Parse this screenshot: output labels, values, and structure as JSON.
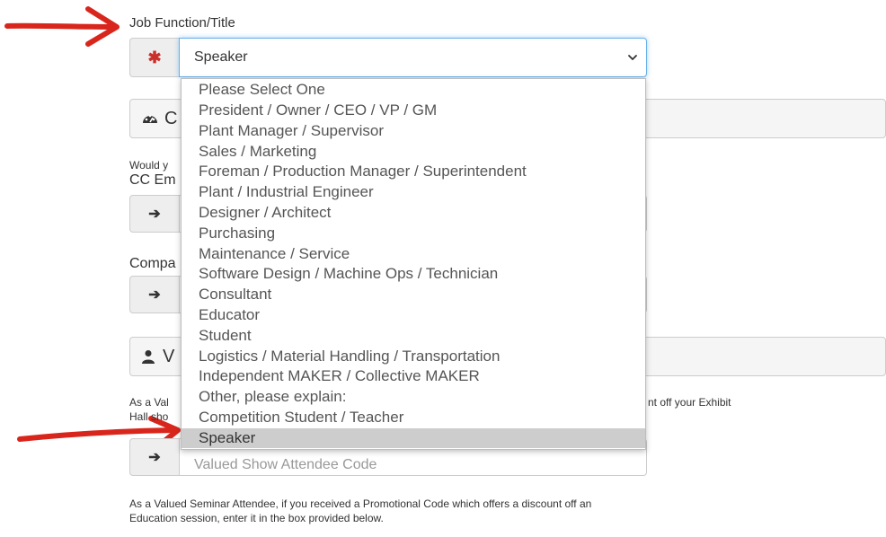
{
  "job_function": {
    "label": "Job Function/Title",
    "required_mark": "✱",
    "selected_value": "Speaker",
    "options": [
      "Please Select One",
      "President / Owner / CEO / VP / GM",
      "Plant Manager / Supervisor",
      "Sales / Marketing",
      "Foreman / Production Manager / Superintendent",
      "Plant / Industrial Engineer",
      "Designer / Architect",
      "Purchasing",
      "Maintenance / Service",
      "Software Design / Machine Ops / Technician",
      "Consultant",
      "Educator",
      "Student",
      "Logistics / Material Handling / Transportation",
      "Independent MAKER / Collective MAKER",
      "Other, please explain:",
      "Competition Student / Teacher",
      "Speaker"
    ]
  },
  "company_section": {
    "heading_partial": "C"
  },
  "cc_email": {
    "intro_partial": "Would y",
    "label_partial": "CC Em"
  },
  "company": {
    "label_partial": "Compa"
  },
  "valued_section": {
    "heading_partial": "V"
  },
  "exhibit": {
    "help_line1_left": "As a Val",
    "help_line1_right": "nt off your Exhibit",
    "help_line2_left": "Hall sho",
    "code_placeholder": "Valued Show Attendee Code"
  },
  "seminar": {
    "help_line1": "As a Valued Seminar Attendee, if you received a Promotional Code which offers a discount off an",
    "help_line2": "Education session, enter it in the box provided below."
  },
  "colors": {
    "required": "#c9302c",
    "focus_border": "#66afe9",
    "annotation_arrow": "#d9261c",
    "addon_bg": "#eeeeee",
    "selected_option_bg": "#cdcdcd"
  }
}
